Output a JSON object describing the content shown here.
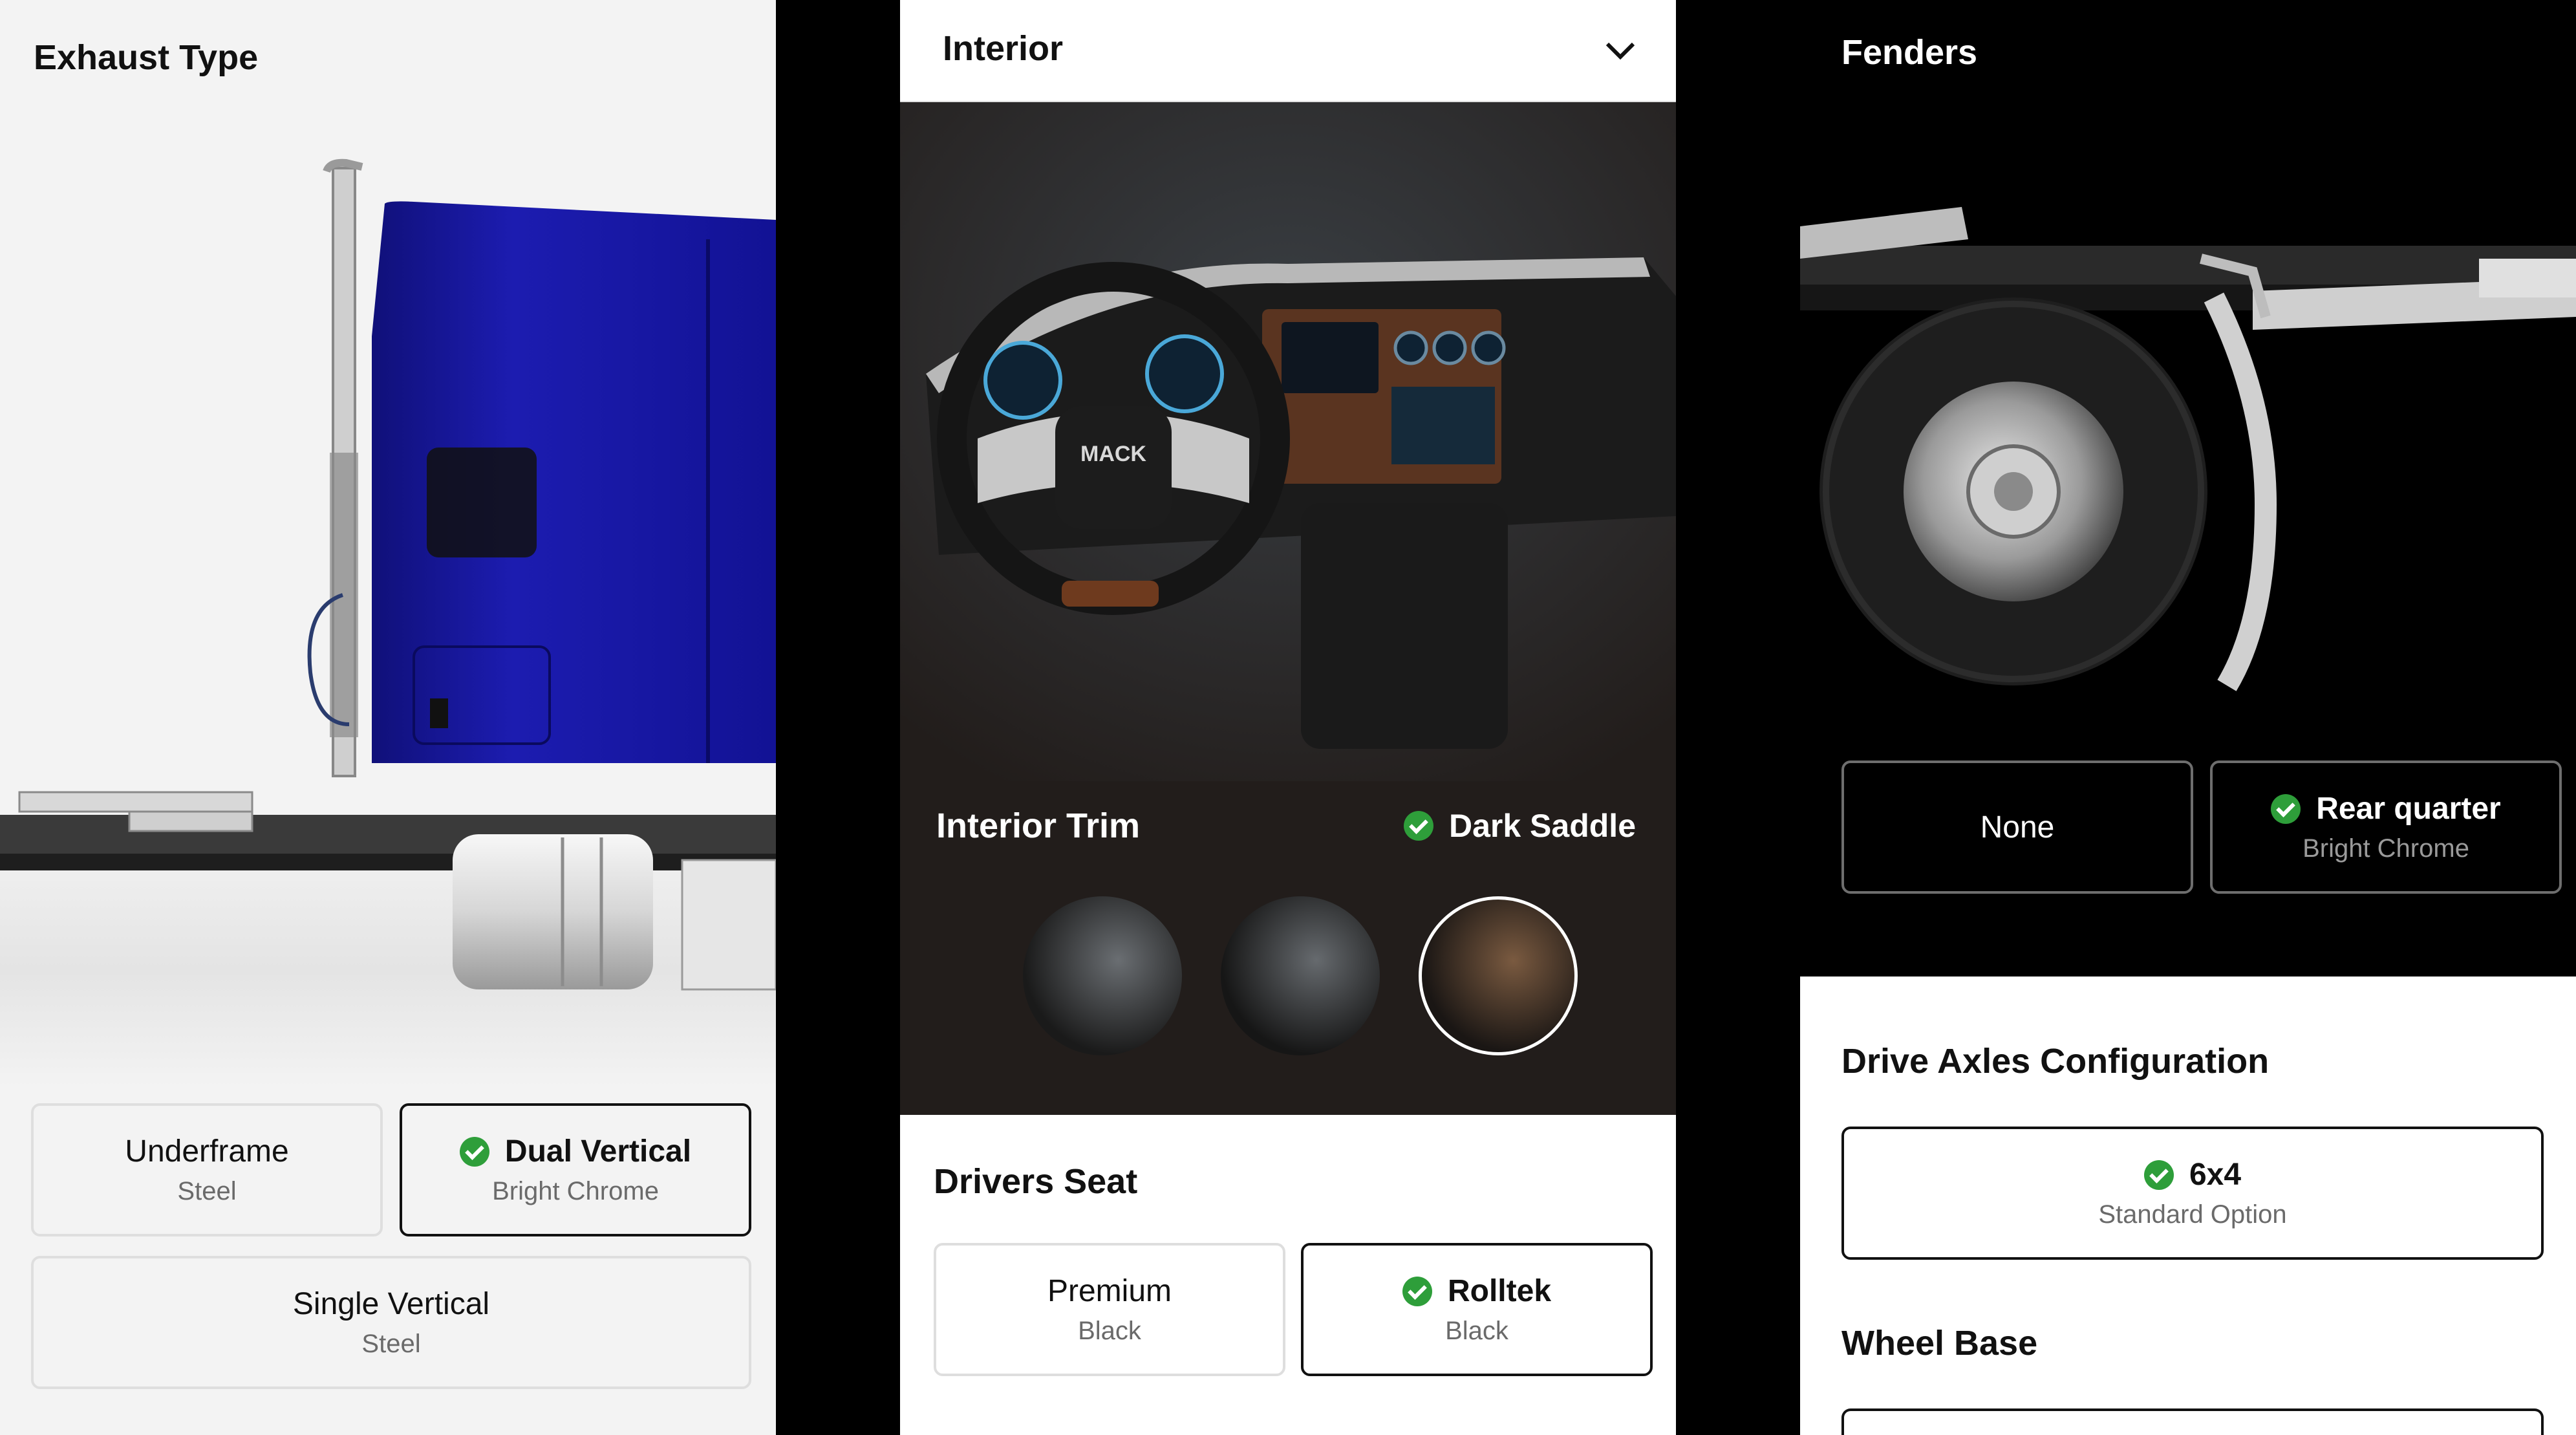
{
  "left": {
    "title": "Exhaust Type",
    "options": [
      {
        "name": "Underframe",
        "sub": "Steel",
        "selected": false
      },
      {
        "name": "Dual Vertical",
        "sub": "Bright Chrome",
        "selected": true
      },
      {
        "name": "Single Vertical",
        "sub": "Steel",
        "selected": false
      }
    ]
  },
  "center": {
    "dropdown_label": "Interior",
    "trim": {
      "title": "Interior Trim",
      "selected_value": "Dark Saddle"
    },
    "seat": {
      "title": "Drivers Seat",
      "options": [
        {
          "name": "Premium",
          "sub": "Black",
          "selected": false
        },
        {
          "name": "Rolltek",
          "sub": "Black",
          "selected": true
        }
      ]
    }
  },
  "right": {
    "fenders": {
      "title": "Fenders",
      "options": [
        {
          "name": "None",
          "selected": false
        },
        {
          "name": "Rear quarter",
          "sub": "Bright Chrome",
          "selected": true
        }
      ]
    },
    "axles": {
      "title": "Drive Axles Configuration",
      "option": {
        "name": "6x4",
        "sub": "Standard Option",
        "selected": true
      }
    },
    "wheelbase": {
      "title": "Wheel Base"
    }
  },
  "icons": {
    "check": "check-circle-icon",
    "dropdown": "chevron-down-icon"
  },
  "colors": {
    "check_green": "#2e9e3a",
    "truck_blue": "#1a1aa6",
    "interior_bg": "#221d1b"
  }
}
